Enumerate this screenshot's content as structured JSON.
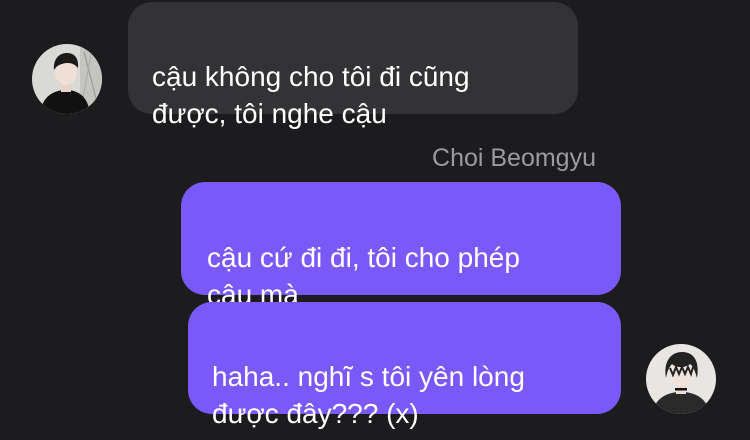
{
  "colors": {
    "background": "#1c1c1e",
    "incoming_bubble": "#333336",
    "outgoing_bubble": "#7a59f8",
    "sender_name": "#9a9a9f"
  },
  "messages": {
    "incoming": {
      "text": "cậu không cho tôi đi cũng\nđược, tôi nghe cậu",
      "avatar_icon": "profile-photo-icon"
    },
    "sender_name": "Choi Beomgyu",
    "outgoing": [
      {
        "text": "cậu cứ đi đi, tôi cho phép\ncậu mà"
      },
      {
        "text": "haha.. nghĩ s tôi yên lòng\nđược đây??? (x)",
        "avatar_icon": "profile-photo-icon"
      }
    ]
  }
}
